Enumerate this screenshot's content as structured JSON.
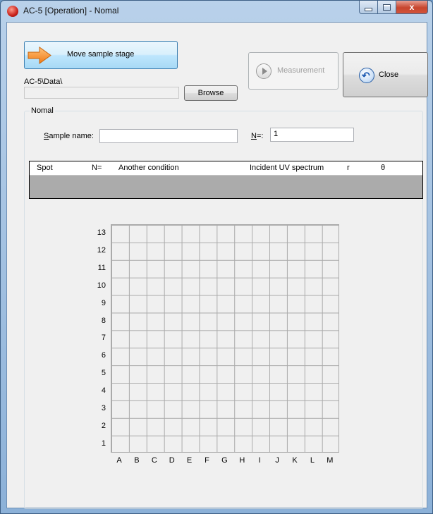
{
  "window": {
    "title": "AC-5 [Operation] - Nomal",
    "close_glyph": "x"
  },
  "toolbar": {
    "move_label": "Move sample stage",
    "data_path": "AC-5\\Data\\",
    "browse_label": "Browse",
    "measurement_label": "Measurement",
    "close_label": "Close"
  },
  "form": {
    "group_label": "Nomal",
    "sample_label_u": "S",
    "sample_label_rest": "ample name:",
    "sample_value": "",
    "n_label_u": "N",
    "n_label_rest": "=:",
    "n_value": "1"
  },
  "table": {
    "columns": [
      "Spot",
      "N=",
      "Another condition",
      "Incident UV spectrum",
      "r",
      "θ"
    ]
  },
  "plate": {
    "rows": [
      "13",
      "12",
      "11",
      "10",
      "9",
      "8",
      "7",
      "6",
      "5",
      "4",
      "3",
      "2",
      "1"
    ],
    "cols": [
      "A",
      "B",
      "C",
      "D",
      "E",
      "F",
      "G",
      "H",
      "I",
      "J",
      "K",
      "L",
      "M"
    ]
  },
  "icons": {
    "move": "arrow-right-icon",
    "measure": "play-icon",
    "close": "undo-icon"
  }
}
